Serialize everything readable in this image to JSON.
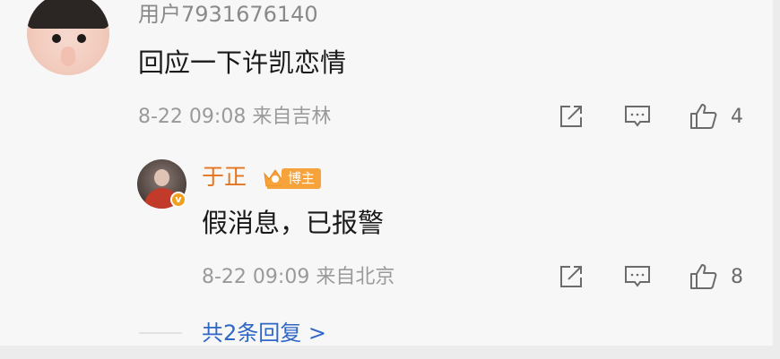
{
  "comment": {
    "username": "用户7931676140",
    "text": "回应一下许凯恋情",
    "time_location": "8-22 09:08 来自吉林",
    "like_count": "4"
  },
  "reply": {
    "username": "于正",
    "badge_label": "博主",
    "verified_badge": "v",
    "text": "假消息，已报警",
    "time_location": "8-22 09:09 来自北京",
    "like_count": "8"
  },
  "more_replies": "共2条回复 >",
  "colors": {
    "reply_username": "#e5741f",
    "badge": "#f7a33c",
    "link": "#2f67c4"
  },
  "icons": [
    "share-icon",
    "comment-icon",
    "like-icon",
    "verified-icon",
    "crown-icon"
  ]
}
